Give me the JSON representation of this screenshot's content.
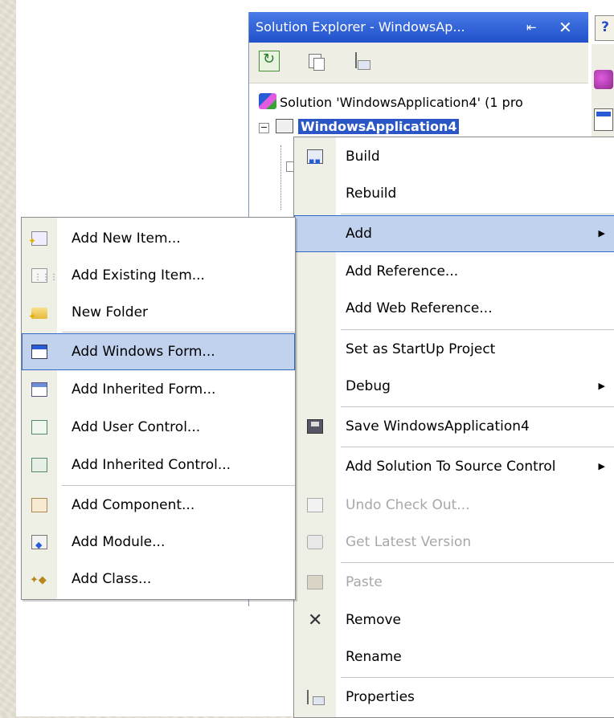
{
  "solution_explorer": {
    "title": "Solution Explorer - WindowsAp...",
    "pin_glyph": "⇤",
    "close_glyph": "✕",
    "help_glyph": "?",
    "tree": {
      "solution_label": "Solution 'WindowsApplication4' (1 pro",
      "project_label": "WindowsApplication4",
      "expander_glyph": "−"
    }
  },
  "context_menu": {
    "items": [
      {
        "label": "Build",
        "icon": "build-icon"
      },
      {
        "label": "Rebuild",
        "icon": ""
      },
      {
        "label": "Add",
        "icon": "",
        "submenu": true,
        "selected": true
      },
      {
        "label": "Add Reference...",
        "icon": ""
      },
      {
        "label": "Add Web Reference...",
        "icon": ""
      },
      {
        "label": "Set as StartUp Project",
        "icon": ""
      },
      {
        "label": "Debug",
        "icon": "",
        "submenu": true
      },
      {
        "label": "Save WindowsApplication4",
        "icon": "save-icon"
      },
      {
        "label": "Add Solution To Source Control",
        "icon": "",
        "submenu": true
      },
      {
        "label": "Undo Check Out...",
        "icon": "undo-checkout-icon",
        "disabled": true
      },
      {
        "label": "Get Latest Version",
        "icon": "get-latest-icon",
        "disabled": true
      },
      {
        "label": "Paste",
        "icon": "paste-icon",
        "disabled": true
      },
      {
        "label": "Remove",
        "icon": "remove-icon"
      },
      {
        "label": "Rename",
        "icon": ""
      },
      {
        "label": "Properties",
        "icon": "properties-icon"
      }
    ],
    "arrow_glyph": "▶"
  },
  "add_submenu": {
    "items": [
      {
        "label": "Add New Item...",
        "icon": "new-item-icon"
      },
      {
        "label": "Add Existing Item...",
        "icon": "existing-item-icon"
      },
      {
        "label": "New Folder",
        "icon": "new-folder-icon"
      },
      {
        "label": "Add Windows Form...",
        "icon": "windows-form-icon",
        "selected": true
      },
      {
        "label": "Add Inherited Form...",
        "icon": "inherited-form-icon"
      },
      {
        "label": "Add User Control...",
        "icon": "user-control-icon"
      },
      {
        "label": "Add Inherited Control...",
        "icon": "inherited-control-icon"
      },
      {
        "label": "Add Component...",
        "icon": "component-icon"
      },
      {
        "label": "Add Module...",
        "icon": "module-icon"
      },
      {
        "label": "Add Class...",
        "icon": "class-icon"
      }
    ]
  }
}
